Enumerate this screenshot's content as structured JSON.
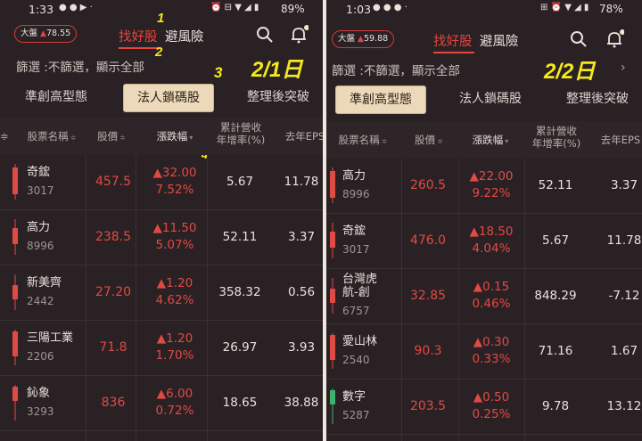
{
  "left": {
    "status": {
      "time": "1:33",
      "battery": "89%"
    },
    "market_chip": {
      "label": "大盤",
      "value": "78.55"
    },
    "nav": {
      "tab1": "找好股",
      "tab2": "避風險"
    },
    "filter_text": "篩選 :不篩選，顯示全部",
    "date_label": "2/1日",
    "annotations": {
      "a1": "1",
      "a2": "2",
      "a3": "3",
      "a4": "4"
    },
    "sub_tabs": [
      "準創高型態",
      "法人鎖碼股",
      "整理後突破"
    ],
    "columns": {
      "name": "股票名稱",
      "price": "股價",
      "change": "漲跌幅",
      "revenue": "累計營收\n年增率(%)",
      "eps": "去年EPS"
    },
    "rows": [
      {
        "name": "奇鋐",
        "code": "3017",
        "price": "457.5",
        "chg": "▲32.00",
        "pct": "7.52%",
        "rev": "5.67",
        "eps": "11.78"
      },
      {
        "name": "高力",
        "code": "8996",
        "price": "238.5",
        "chg": "▲11.50",
        "pct": "5.07%",
        "rev": "52.11",
        "eps": "3.37"
      },
      {
        "name": "新美齊",
        "code": "2442",
        "price": "27.20",
        "chg": "▲1.20",
        "pct": "4.62%",
        "rev": "358.32",
        "eps": "0.56"
      },
      {
        "name": "三陽工業",
        "code": "2206",
        "price": "71.8",
        "chg": "▲1.20",
        "pct": "1.70%",
        "rev": "26.97",
        "eps": "3.93"
      },
      {
        "name": "鈊象",
        "code": "3293",
        "price": "836",
        "chg": "▲6.00",
        "pct": "0.72%",
        "rev": "18.65",
        "eps": "38.88"
      }
    ]
  },
  "right": {
    "status": {
      "time": "1:03",
      "battery": "78%"
    },
    "market_chip": {
      "label": "大盤",
      "value": "59.88"
    },
    "nav": {
      "tab1": "找好股",
      "tab2": "避風險"
    },
    "filter_text": "篩選 :不篩選，顯示全部",
    "date_label": "2/2日",
    "sub_tabs": [
      "準創高型態",
      "法人鎖碼股",
      "整理後突破"
    ],
    "columns": {
      "name": "股票名稱",
      "price": "股價",
      "change": "漲跌幅",
      "revenue": "累計營收\n年增率(%)",
      "eps": "去年EPS"
    },
    "rows": [
      {
        "name": "高力",
        "code": "8996",
        "price": "260.5",
        "chg": "▲22.00",
        "pct": "9.22%",
        "rev": "52.11",
        "eps": "3.37"
      },
      {
        "name": "奇鋐",
        "code": "3017",
        "price": "476.0",
        "chg": "▲18.50",
        "pct": "4.04%",
        "rev": "5.67",
        "eps": "11.78"
      },
      {
        "name": "台灣虎\n航-創",
        "code": "6757",
        "price": "32.85",
        "chg": "▲0.15",
        "pct": "0.46%",
        "rev": "848.29",
        "eps": "-7.12"
      },
      {
        "name": "愛山林",
        "code": "2540",
        "price": "90.3",
        "chg": "▲0.30",
        "pct": "0.33%",
        "rev": "71.16",
        "eps": "1.67"
      },
      {
        "name": "數字",
        "code": "5287",
        "price": "203.5",
        "chg": "▲0.50",
        "pct": "0.25%",
        "rev": "9.78",
        "eps": "13.12"
      }
    ]
  },
  "colors": {
    "accent": "#e8453c",
    "up": "#e04a45",
    "highlight": "#f4e81e",
    "active_tab_bg": "#ecd9b9"
  },
  "icons": [
    "search-icon",
    "bell-icon",
    "chevron-right-icon",
    "sort-icon"
  ]
}
